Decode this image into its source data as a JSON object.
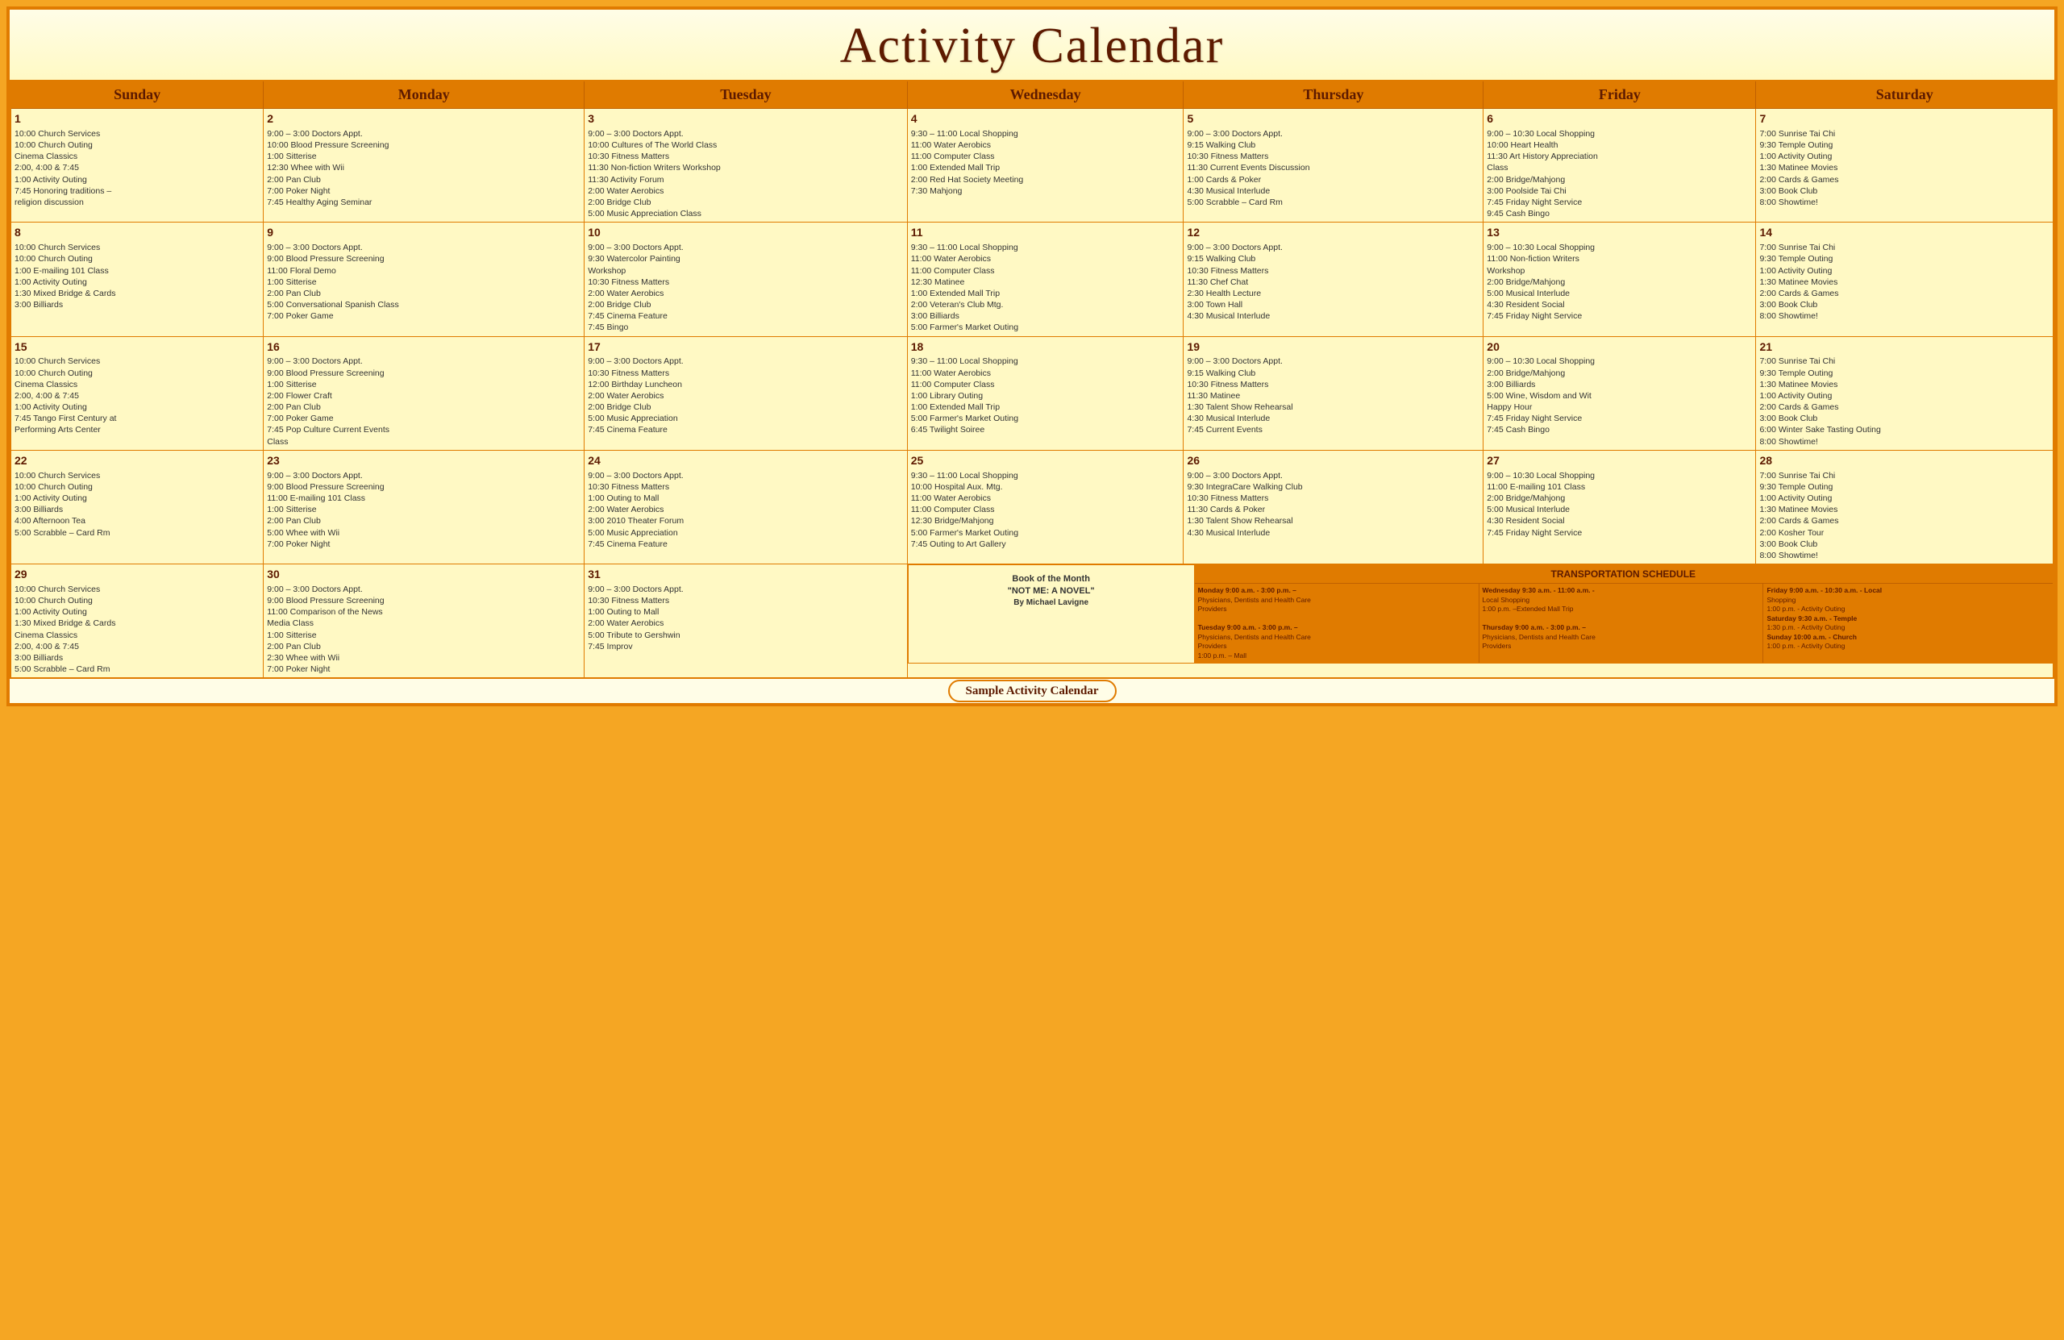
{
  "title": "Activity Calendar",
  "days": [
    "Sunday",
    "Monday",
    "Tuesday",
    "Wednesday",
    "Thursday",
    "Friday",
    "Saturday"
  ],
  "week1": {
    "sun": {
      "num": "1",
      "events": [
        "10:00 Church Services",
        "10:00 Church Outing",
        "Cinema Classics",
        "2:00, 4:00 & 7:45",
        "1:00 Activity Outing",
        "7:45 Honoring traditions –",
        "religion discussion"
      ]
    },
    "mon": {
      "num": "2",
      "events": [
        "9:00 – 3:00 Doctors Appt.",
        "10:00 Blood Pressure Screening",
        "1:00 Sitterise",
        "12:30 Whee with Wii",
        "2:00 Pan Club",
        "7:00 Poker Night",
        "7:45 Healthy Aging Seminar"
      ]
    },
    "tue": {
      "num": "3",
      "events": [
        "9:00 – 3:00 Doctors Appt.",
        "10:00 Cultures of The World Class",
        "10:30 Fitness Matters",
        "11:30 Non-fiction Writers Workshop",
        "11:30 Activity Forum",
        "2:00 Water Aerobics",
        "2:00 Bridge Club",
        "5:00 Music Appreciation Class"
      ]
    },
    "wed": {
      "num": "4",
      "events": [
        "9:30 – 11:00 Local Shopping",
        "11:00 Water Aerobics",
        "11:00 Computer Class",
        "1:00 Extended Mall Trip",
        "2:00 Red Hat Society Meeting",
        "7:30 Mahjong"
      ]
    },
    "thu": {
      "num": "5",
      "events": [
        "9:00 – 3:00 Doctors Appt.",
        "9:15 Walking Club",
        "10:30 Fitness Matters",
        "11:30 Current Events Discussion",
        "1:00 Cards & Poker",
        "4:30 Musical Interlude",
        "5:00 Scrabble – Card Rm"
      ]
    },
    "fri": {
      "num": "6",
      "events": [
        "9:00 – 10:30 Local Shopping",
        "10:00 Heart Health",
        "11:30 Art History Appreciation",
        "Class",
        "2:00 Bridge/Mahjong",
        "3:00 Poolside Tai Chi",
        "7:45 Friday Night Service",
        "9:45 Cash Bingo"
      ]
    },
    "sat": {
      "num": "7",
      "events": [
        "7:00 Sunrise Tai Chi",
        "9:30 Temple Outing",
        "1:00 Activity Outing",
        "1:30 Matinee Movies",
        "2:00 Cards & Games",
        "3:00 Book Club",
        "8:00 Showtime!"
      ]
    }
  },
  "week2": {
    "sun": {
      "num": "8",
      "events": [
        "10:00 Church Services",
        "10:00 Church Outing",
        "1:00 E-mailing 101 Class",
        "1:00 Activity Outing",
        "1:30 Mixed Bridge & Cards",
        "3:00 Billiards"
      ]
    },
    "mon": {
      "num": "9",
      "events": [
        "9:00 – 3:00 Doctors Appt.",
        "9:00 Blood Pressure Screening",
        "11:00 Floral Demo",
        "1:00 Sitterise",
        "2:00 Pan Club",
        "5:00 Conversational Spanish Class",
        "7:00 Poker Game"
      ]
    },
    "tue": {
      "num": "10",
      "events": [
        "9:00 – 3:00 Doctors Appt.",
        "9:30 Watercolor Painting",
        "Workshop",
        "10:30 Fitness Matters",
        "2:00 Water Aerobics",
        "2:00 Bridge Club",
        "7:45 Cinema Feature",
        "7:45 Bingo"
      ]
    },
    "wed": {
      "num": "11",
      "events": [
        "9:30 – 11:00 Local Shopping",
        "11:00 Water Aerobics",
        "11:00 Computer Class",
        "12:30 Matinee",
        "1:00 Extended Mall Trip",
        "2:00 Veteran's Club Mtg.",
        "3:00 Billiards",
        "5:00 Farmer's Market Outing"
      ]
    },
    "thu": {
      "num": "12",
      "events": [
        "9:00 – 3:00 Doctors Appt.",
        "9:15 Walking Club",
        "10:30 Fitness Matters",
        "11:30 Chef Chat",
        "2:30 Health Lecture",
        "3:00 Town Hall",
        "4:30 Musical Interlude"
      ]
    },
    "fri": {
      "num": "13",
      "events": [
        "9:00 – 10:30 Local Shopping",
        "11:00 Non-fiction Writers",
        "Workshop",
        "2:00 Bridge/Mahjong",
        "5:00 Musical Interlude",
        "4:30 Resident Social",
        "7:45 Friday Night Service"
      ]
    },
    "sat": {
      "num": "14",
      "events": [
        "7:00 Sunrise Tai Chi",
        "9:30 Temple Outing",
        "1:00 Activity Outing",
        "1:30 Matinee Movies",
        "2:00 Cards & Games",
        "3:00 Book Club",
        "8:00 Showtime!"
      ]
    }
  },
  "week3": {
    "sun": {
      "num": "15",
      "events": [
        "10:00 Church Services",
        "10:00 Church Outing",
        "Cinema Classics",
        "2:00, 4:00 & 7:45",
        "1:00 Activity Outing",
        "7:45 Tango First Century at",
        "Performing Arts Center"
      ]
    },
    "mon": {
      "num": "16",
      "events": [
        "9:00 – 3:00 Doctors Appt.",
        "9:00 Blood Pressure Screening",
        "1:00 Sitterise",
        "2:00 Flower Craft",
        "2:00 Pan Club",
        "7:00 Poker Game",
        "7:45 Pop Culture Current Events",
        "Class"
      ]
    },
    "tue": {
      "num": "17",
      "events": [
        "9:00 – 3:00 Doctors Appt.",
        "10:30 Fitness Matters",
        "12:00 Birthday Luncheon",
        "2:00 Water Aerobics",
        "2:00 Bridge Club",
        "5:00 Music Appreciation",
        "7:45 Cinema Feature"
      ]
    },
    "wed": {
      "num": "18",
      "events": [
        "9:30 – 11:00 Local Shopping",
        "11:00 Water Aerobics",
        "11:00 Computer Class",
        "1:00 Library Outing",
        "1:00 Extended Mall Trip",
        "5:00 Farmer's Market Outing",
        "6:45 Twilight Soiree"
      ]
    },
    "thu": {
      "num": "19",
      "events": [
        "9:00 – 3:00 Doctors Appt.",
        "9:15 Walking Club",
        "10:30 Fitness Matters",
        "11:30 Matinee",
        "1:30 Talent Show Rehearsal",
        "4:30 Musical Interlude",
        "7:45 Current Events"
      ]
    },
    "fri": {
      "num": "20",
      "events": [
        "9:00 – 10:30 Local Shopping",
        "2:00 Bridge/Mahjong",
        "3:00 Billiards",
        "5:00 Wine, Wisdom and Wit",
        "Happy Hour",
        "7:45 Friday Night Service",
        "7:45 Cash Bingo"
      ]
    },
    "sat": {
      "num": "21",
      "events": [
        "7:00 Sunrise Tai Chi",
        "9:30 Temple Outing",
        "1:30 Matinee Movies",
        "1:00 Activity Outing",
        "2:00 Cards & Games",
        "3:00 Book Club",
        "6:00 Winter Sake Tasting Outing",
        "8:00 Showtime!"
      ]
    }
  },
  "week4": {
    "sun": {
      "num": "22",
      "events": [
        "10:00 Church Services",
        "10:00 Church Outing",
        "1:00 Activity Outing",
        "3:00 Billiards",
        "4:00 Afternoon Tea",
        "5:00 Scrabble – Card Rm"
      ]
    },
    "mon": {
      "num": "23",
      "events": [
        "9:00 – 3:00 Doctors Appt.",
        "9:00 Blood Pressure Screening",
        "11:00 E-mailing 101 Class",
        "1:00 Sitterise",
        "2:00 Pan Club",
        "5:00 Whee with Wii",
        "7:00 Poker Night"
      ]
    },
    "tue": {
      "num": "24",
      "events": [
        "9:00 – 3:00 Doctors Appt.",
        "10:30 Fitness Matters",
        "1:00 Outing to Mall",
        "2:00 Water Aerobics",
        "3:00 2010 Theater Forum",
        "5:00 Music Appreciation",
        "7:45 Cinema Feature"
      ]
    },
    "wed": {
      "num": "25",
      "events": [
        "9:30 – 11:00 Local Shopping",
        "10:00 Hospital Aux. Mtg.",
        "11:00 Water Aerobics",
        "11:00 Computer Class",
        "12:30 Bridge/Mahjong",
        "5:00 Farmer's Market Outing",
        "7:45 Outing to Art Gallery"
      ]
    },
    "thu": {
      "num": "26",
      "events": [
        "9:00 – 3:00 Doctors Appt.",
        "9:30 IntegraCare Walking Club",
        "10:30 Fitness Matters",
        "11:30 Cards & Poker",
        "1:30 Talent Show Rehearsal",
        "4:30 Musical Interlude"
      ]
    },
    "fri": {
      "num": "27",
      "events": [
        "9:00 – 10:30 Local Shopping",
        "11:00 E-mailing 101 Class",
        "2:00 Bridge/Mahjong",
        "5:00 Musical Interlude",
        "4:30 Resident Social",
        "7:45 Friday Night Service"
      ]
    },
    "sat": {
      "num": "28",
      "events": [
        "7:00 Sunrise Tai Chi",
        "9:30 Temple Outing",
        "1:00 Activity Outing",
        "1:30 Matinee Movies",
        "2:00 Cards & Games",
        "2:00 Kosher Tour",
        "3:00 Book Club",
        "8:00 Showtime!"
      ]
    }
  },
  "week5": {
    "sun": {
      "num": "29",
      "events": [
        "10:00 Church Services",
        "10:00 Church Outing",
        "1:00 Activity Outing",
        "1:30 Mixed Bridge & Cards",
        "Cinema Classics",
        "2:00, 4:00 & 7:45",
        "3:00 Billiards",
        "5:00 Scrabble – Card Rm"
      ]
    },
    "mon": {
      "num": "30",
      "events": [
        "9:00 – 3:00 Doctors Appt.",
        "9:00 Blood Pressure Screening",
        "11:00 Comparison of the News",
        "Media Class",
        "1:00 Sitterise",
        "2:00 Pan Club",
        "2:30 Whee with Wii",
        "7:00 Poker Night"
      ]
    },
    "tue": {
      "num": "31",
      "events": [
        "9:00 – 3:00 Doctors Appt.",
        "10:30 Fitness Matters",
        "1:00 Outing to Mall",
        "2:00 Water Aerobics",
        "5:00 Tribute to Gershwin",
        "7:45 Improv"
      ]
    },
    "book": {
      "title": "Book of the Month",
      "subtitle": "\"NOT ME: A NOVEL\"",
      "author": "By Michael Lavigne"
    },
    "transport_header": "TRANSPORTATION SCHEDULE",
    "t_monday": {
      "label": "Monday 9:00 a.m. - 3:00 p.m. –",
      "line1": "Physicians, Dentists and Health Care",
      "line2": "Providers"
    },
    "t_tuesday": {
      "label": "Tuesday 9:00 a.m. - 3:00 p.m. –",
      "line1": "Physicians, Dentists and Health Care",
      "line2": "Providers",
      "line3": "1:00 p.m. – Mall"
    },
    "t_wednesday": {
      "label": "Wednesday 9:30 a.m. - 11:00 a.m. -",
      "line1": "Local Shopping",
      "line2": "1:00 p.m. –Extended Mall Trip"
    },
    "t_thursday": {
      "label": "Thursday 9:00 a.m. - 3:00 p.m. –",
      "line1": "Physicians, Dentists and Health Care",
      "line2": "Providers"
    },
    "t_friday": {
      "label": "Friday 9:00 a.m. - 10:30 a.m. - Local",
      "line1": "Shopping",
      "line2": "1:00 p.m. - Activity Outing"
    },
    "t_saturday": {
      "label": "Saturday 9:30 a.m. - Temple",
      "line1": "1:30 p.m. - Activity Outing"
    },
    "t_sunday": {
      "label": "Sunday 10:00 a.m. - Church",
      "line1": "1:00 p.m. - Activity Outing"
    }
  },
  "bottom_label": "Sample Activity Calendar"
}
